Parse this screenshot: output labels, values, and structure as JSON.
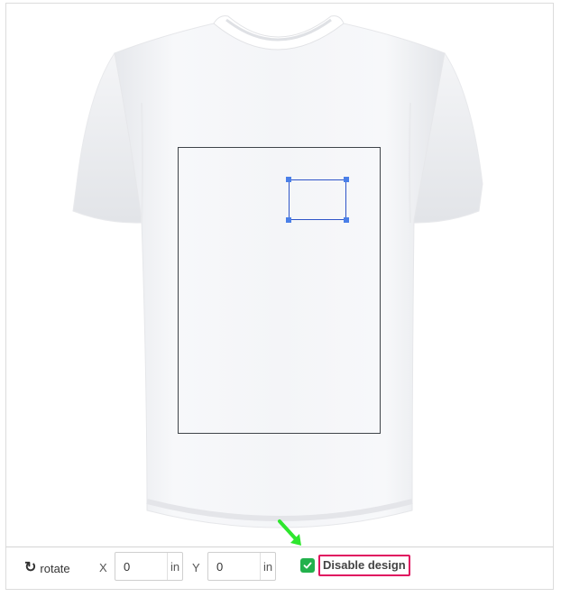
{
  "toolbar": {
    "rotate_label": "rotate",
    "x_label": "X",
    "x_value": "0",
    "x_unit": "in",
    "y_label": "Y",
    "y_value": "0",
    "y_unit": "in",
    "disable_design_label": "Disable design",
    "disable_design_checked": true
  },
  "icons": {
    "rotate": "rotate-clockwise-icon",
    "check": "check-icon",
    "annotation_arrow": "green-arrow-icon"
  },
  "colors": {
    "design_selection": "#2f55c8",
    "handle": "#4a7fe8",
    "checkbox": "#22b14c",
    "highlight": "#e0115f",
    "arrow": "#2ee62e"
  }
}
